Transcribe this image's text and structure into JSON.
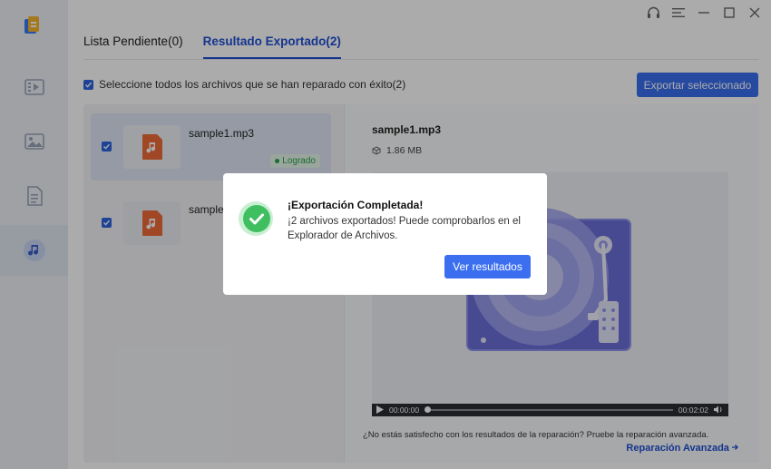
{
  "tabs": [
    {
      "label": "Lista Pendiente(0)"
    },
    {
      "label": "Resultado Exportado(2)"
    }
  ],
  "select_all_label": "Seleccione todos los archivos que se han reparado con éxito(2)",
  "export_button": "Exportar seleccionado",
  "files": [
    {
      "name": "sample1.mp3",
      "status": "Logrado"
    },
    {
      "name": "sample2.mp3"
    }
  ],
  "preview": {
    "name": "sample1.mp3",
    "size": "1.86 MB",
    "time_current": "00:00:00",
    "time_total": "00:02:02",
    "hint": "¿No estás satisfecho con los resultados de la reparación? Pruebe la reparación avanzada.",
    "advanced_link": "Reparación Avanzada"
  },
  "dialog": {
    "title": "¡Exportación Completada!",
    "body": "¡2 archivos exportados! Puede comprobarlos en el Explorador de Archivos.",
    "button": "Ver resultados"
  },
  "icons": [
    "app-logo-icon",
    "video-icon",
    "image-icon",
    "document-icon",
    "music-icon",
    "headset-icon",
    "menu-icon",
    "minimize-icon",
    "maximize-icon",
    "close-icon",
    "check-icon",
    "music-file-icon",
    "cube-icon",
    "play-icon",
    "volume-icon",
    "success-icon",
    "arrow-right-icon"
  ],
  "colors": {
    "accent": "#3b6ff0",
    "success": "#27a348",
    "file_icon": "#ef6a3a"
  }
}
